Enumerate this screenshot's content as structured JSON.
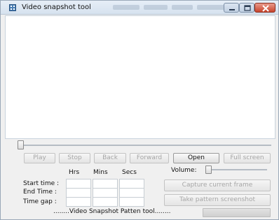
{
  "window": {
    "title": "Video snapshot tool",
    "app_icon": "film-icon",
    "controls": {
      "minimize": "minimize-icon",
      "maximize": "maximize-icon",
      "close": "close-icon"
    }
  },
  "player": {
    "seek_position": 0,
    "buttons": {
      "play": "Play",
      "stop": "Stop",
      "back": "Back",
      "forward": "Forward",
      "open": "Open",
      "fullscreen": "Full screen"
    }
  },
  "timing": {
    "columns": [
      "Hrs",
      "Mins",
      "Secs"
    ],
    "rows": [
      {
        "label": "Start time :",
        "hrs": "",
        "mins": "",
        "secs": ""
      },
      {
        "label": "End Time :",
        "hrs": "",
        "mins": "",
        "secs": ""
      },
      {
        "label": "Time gap :",
        "hrs": "",
        "mins": "",
        "secs": ""
      }
    ]
  },
  "volume": {
    "label": "Volume:",
    "level": 0
  },
  "actions": {
    "capture": "Capture current frame",
    "pattern": "Take pattern screenshot"
  },
  "footer": {
    "text": "........Video Snapshot Patten tool........"
  },
  "colors": {
    "titlebar": "#dde7f2",
    "close_button": "#c8442d",
    "disabled_text": "#a6a6a6"
  }
}
